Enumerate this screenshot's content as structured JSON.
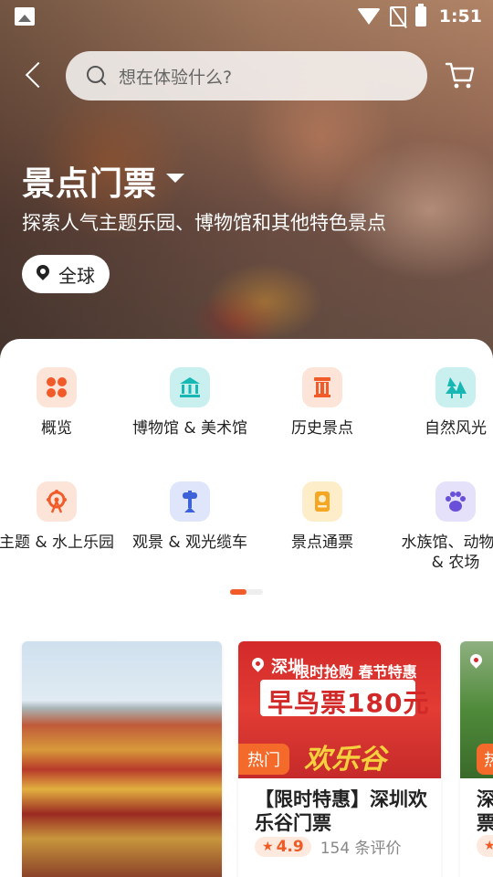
{
  "status_bar": {
    "time": "1:51"
  },
  "header": {
    "search_placeholder": "想在体验什么?"
  },
  "hero": {
    "title": "景点门票",
    "subtitle": "探索人气主题乐园、博物馆和其他特色景点",
    "region": "全球"
  },
  "categories": [
    {
      "label": "概览",
      "icon": "grid-icon",
      "color": "#f15b2a"
    },
    {
      "label": "博物馆 & 美术馆",
      "icon": "museum-icon",
      "color": "#17b8b3"
    },
    {
      "label": "历史景点",
      "icon": "column-icon",
      "color": "#f15b2a"
    },
    {
      "label": "自然风光",
      "icon": "tree-icon",
      "color": "#17b8b3"
    },
    {
      "label": "主题 & 水上乐园",
      "icon": "ferris-wheel-icon",
      "color": "#f15b2a"
    },
    {
      "label": "观景 & 观光缆车",
      "icon": "tower-icon",
      "color": "#3e63d8"
    },
    {
      "label": "景点通票",
      "icon": "pass-icon",
      "color": "#f5a623"
    },
    {
      "label": "水族馆、动物园\n& 农场",
      "icon": "paw-icon",
      "color": "#6a4fd8"
    }
  ],
  "cards": [
    {
      "image": "forbidden-city-photo"
    },
    {
      "location": "深圳",
      "badge": "热门",
      "promo_top": "限时抢购 春节特惠",
      "promo_text": "早鸟票180元",
      "promo_deco": "欢乐谷",
      "title": "【限时特惠】深圳欢乐谷门票",
      "rating": "4.9",
      "reviews": "154 条评价"
    },
    {
      "badge": "热",
      "title": "深圳\n票"
    }
  ],
  "colors": {
    "accent": "#f15b2a",
    "rating_text": "#f05a24"
  }
}
